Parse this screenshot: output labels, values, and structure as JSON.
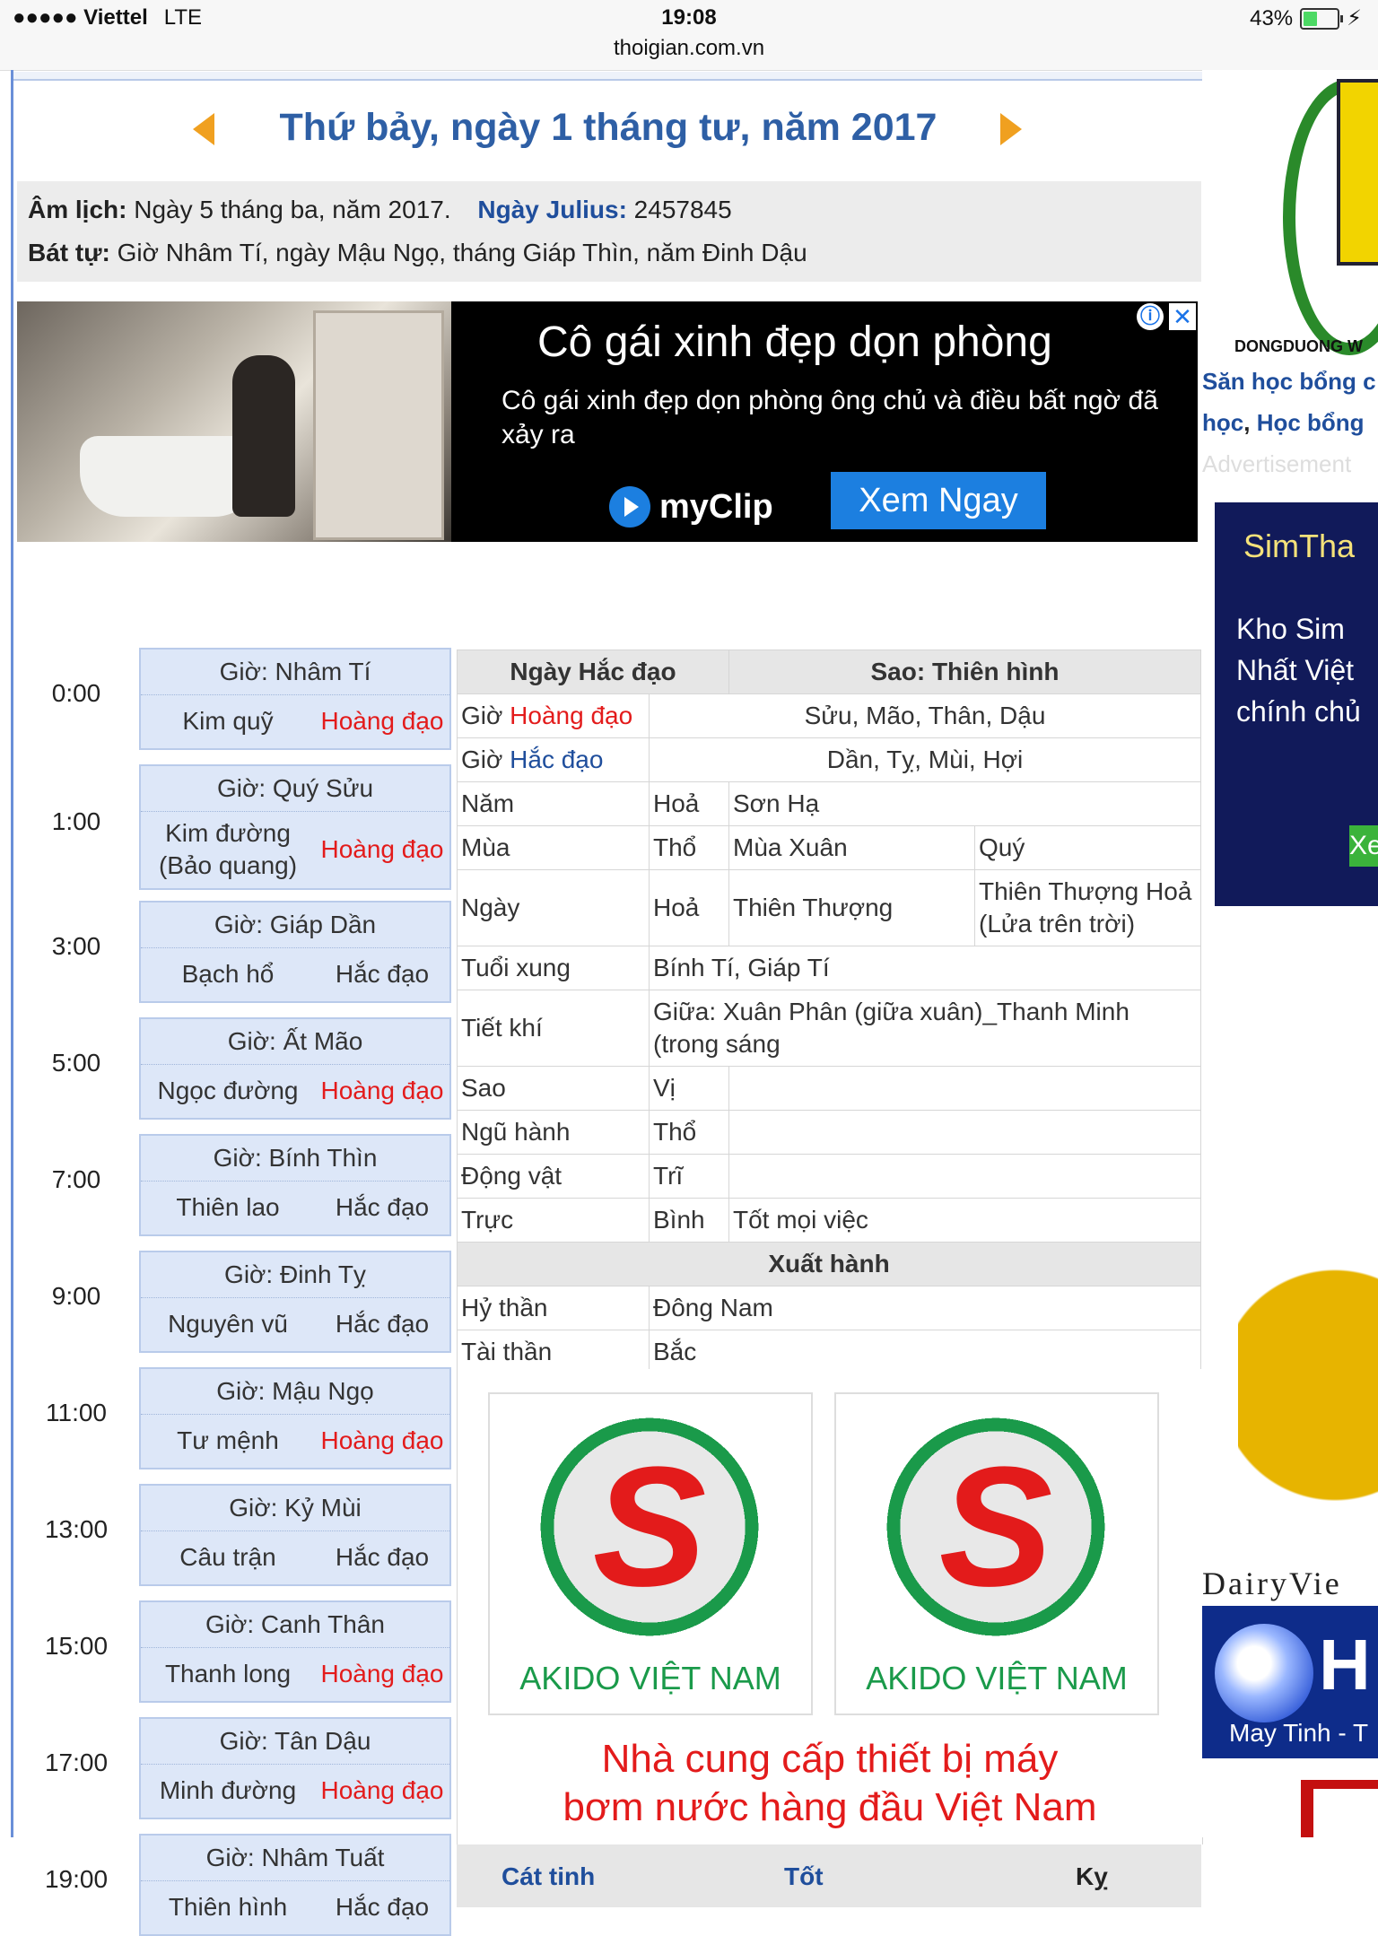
{
  "statusbar": {
    "carrier": "●●●●● Viettel",
    "network": "LTE",
    "time": "19:08",
    "url": "thoigian.com.vn",
    "battery": "43%",
    "battery_level": 0.43
  },
  "header": {
    "title": "Thứ bảy, ngày 1 tháng tư, năm 2017"
  },
  "lunar": {
    "am_lich_label": "Âm lịch:",
    "am_lich_value": "Ngày 5 tháng ba, năm 2017.",
    "julius_label": "Ngày Julius:",
    "julius_value": "2457845",
    "bat_tu_label": "Bát tự:",
    "bat_tu_value": "Giờ Nhâm Tí, ngày Mậu Ngọ, tháng Giáp Thìn, năm Đinh Dậu"
  },
  "ad": {
    "title": "Cô gái xinh đẹp dọn phòng",
    "desc": "Cô gái xinh đẹp dọn phòng ông chủ và điều bất ngờ đã xảy ra",
    "brand": "myClip",
    "cta": "Xem Ngay",
    "info": "ⓘ",
    "close": "✕"
  },
  "hours": [
    {
      "time": "0:00",
      "name": "Giờ: Nhâm Tí",
      "star": "Kim quỹ",
      "dao": "Hoàng đạo",
      "good": true
    },
    {
      "time": "1:00",
      "name": "Giờ: Quý Sửu",
      "star": "Kim đường (Bảo quang)",
      "dao": "Hoàng đạo",
      "good": true
    },
    {
      "time": "3:00",
      "name": "Giờ: Giáp Dần",
      "star": "Bạch hổ",
      "dao": "Hắc đạo",
      "good": false
    },
    {
      "time": "5:00",
      "name": "Giờ: Ất Mão",
      "star": "Ngọc đường",
      "dao": "Hoàng đạo",
      "good": true
    },
    {
      "time": "7:00",
      "name": "Giờ: Bính Thìn",
      "star": "Thiên lao",
      "dao": "Hắc đạo",
      "good": false
    },
    {
      "time": "9:00",
      "name": "Giờ: Đinh Tỵ",
      "star": "Nguyên vũ",
      "dao": "Hắc đạo",
      "good": false
    },
    {
      "time": "11:00",
      "name": "Giờ: Mậu Ngọ",
      "star": "Tư mệnh",
      "dao": "Hoàng đạo",
      "good": true
    },
    {
      "time": "13:00",
      "name": "Giờ: Kỷ Mùi",
      "star": "Câu trận",
      "dao": "Hắc đạo",
      "good": false
    },
    {
      "time": "15:00",
      "name": "Giờ: Canh Thân",
      "star": "Thanh long",
      "dao": "Hoàng đạo",
      "good": true
    },
    {
      "time": "17:00",
      "name": "Giờ: Tân Dậu",
      "star": "Minh đường",
      "dao": "Hoàng đạo",
      "good": true
    },
    {
      "time": "19:00",
      "name": "Giờ: Nhâm Tuất",
      "star": "Thiên hình",
      "dao": "Hắc đạo",
      "good": false
    }
  ],
  "table": {
    "ngay_label": "Ngày Hắc đạo",
    "sao_label": "Sao: Thiên hình",
    "gio_prefix": "Giờ",
    "hoang_dao": "Hoàng đạo",
    "hoang_dao_hours": "Sửu, Mão, Thân, Dậu",
    "hac_dao": "Hắc đạo",
    "hac_dao_hours": "Dần, Tỵ, Mùi, Hợi",
    "rows": {
      "nam": [
        "Năm",
        "Hoả",
        "Sơn Hạ",
        ""
      ],
      "mua": [
        "Mùa",
        "Thổ",
        "Mùa Xuân",
        "Quý"
      ],
      "ngay": [
        "Ngày",
        "Hoả",
        "Thiên Thượng",
        "Thiên Thượng Hoả (Lửa trên trời)"
      ],
      "tuoi_xung": [
        "Tuổi xung",
        "Bính Tí, Giáp Tí"
      ],
      "tiet_khi": [
        "Tiết khí",
        "Giữa: Xuân Phân (giữa xuân)_Thanh Minh (trong sáng"
      ],
      "sao": [
        "Sao",
        "Vị",
        ""
      ],
      "ngu_hanh": [
        "Ngũ hành",
        "Thổ",
        ""
      ],
      "dong_vat": [
        "Động vật",
        "Trĩ",
        ""
      ],
      "truc": [
        "Trực",
        "Bình",
        "Tốt mọi việc"
      ]
    },
    "xuat_hanh": "Xuất hành",
    "hy_than": [
      "Hỷ thần",
      "Đông Nam"
    ],
    "tai_than": [
      "Tài thần",
      "Bắc"
    ]
  },
  "akido": {
    "logo_letter": "S",
    "name": "AKIDO VIỆT NAM",
    "slogan_line1": "Nhà cung cấp thiết bị máy",
    "slogan_line2": "bơm nước hàng đầu Việt Nam"
  },
  "footer_row": {
    "cat_tinh": "Cát tinh",
    "tot": "Tốt",
    "ky": "Kỵ"
  },
  "right_ads": {
    "dongduong": "DONGDUONG W",
    "link1": "Săn học bổng c",
    "link2a": "học",
    "link2b": "Học bổng",
    "advertisement": "Advertisement",
    "sim_title": "SimTha",
    "sim_desc1": "Kho Sim",
    "sim_desc2": "Nhất Việt",
    "sim_desc3": "chính chủ",
    "sim_btn": "Xe",
    "dairy": "DairyVie",
    "blue_h": "H",
    "blue_may": "May Tinh - T"
  },
  "colors": {
    "title_blue": "#2e5fa5",
    "link_blue": "#1f4e9c",
    "hoang_dao_red": "#e31b1b",
    "hour_block_bg": "#dde7f8",
    "akido_green": "#1a9a4a"
  }
}
